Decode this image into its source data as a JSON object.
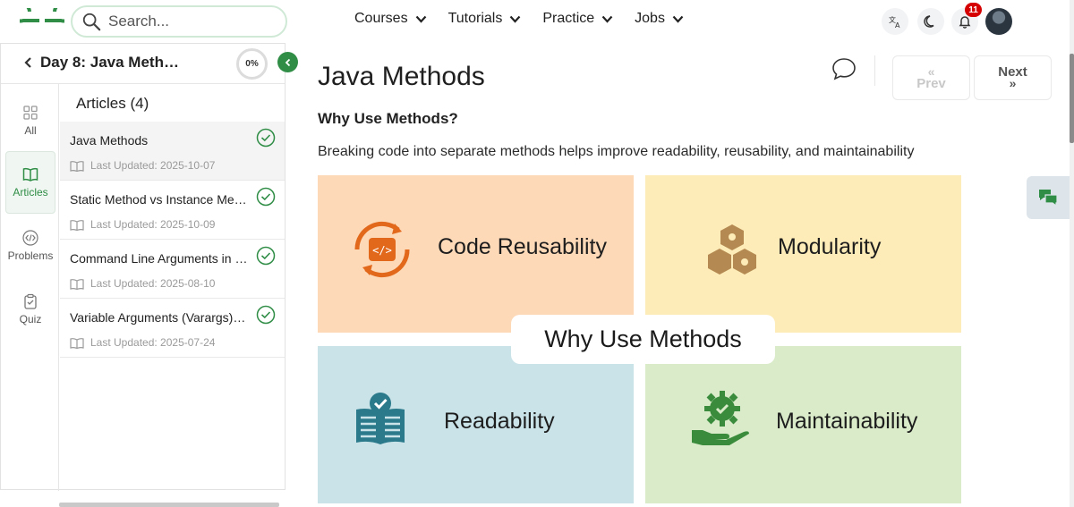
{
  "colors": {
    "brand": "#2f8d46",
    "badge": "#d50000"
  },
  "header": {
    "search_placeholder": "Search...",
    "nav": [
      {
        "label": "Courses"
      },
      {
        "label": "Tutorials"
      },
      {
        "label": "Practice"
      },
      {
        "label": "Jobs"
      }
    ],
    "notification_count": "11",
    "icons": [
      "translate-icon",
      "dark-mode-moon-icon",
      "bell-icon",
      "avatar"
    ]
  },
  "course": {
    "title": "Day 8: Java Meth…",
    "progress": "0%",
    "rail": [
      {
        "label": "All",
        "icon": "grid-icon"
      },
      {
        "label": "Articles",
        "icon": "book-icon",
        "active": true
      },
      {
        "label": "Problems",
        "icon": "code-icon"
      },
      {
        "label": "Quiz",
        "icon": "clipboard-check-icon"
      }
    ],
    "articles_heading": "Articles (4)",
    "articles": [
      {
        "title": "Java Methods",
        "updated": "Last Updated: 2025-10-07",
        "done": true
      },
      {
        "title": "Static Method vs Instance Met…",
        "updated": "Last Updated: 2025-10-09",
        "done": true
      },
      {
        "title": "Command Line Arguments in J…",
        "updated": "Last Updated: 2025-08-10",
        "done": true
      },
      {
        "title": "Variable Arguments (Varargs) i…",
        "updated": "Last Updated: 2025-07-24",
        "done": true
      }
    ]
  },
  "main": {
    "title": "Java Methods",
    "section_heading": "Why Use Methods?",
    "paragraph": "Breaking code into separate methods helps improve readability, reusability, and maintainability",
    "prev_label": "Prev",
    "next_label": "Next",
    "figure": {
      "center_label": "Why Use Methods",
      "quadrants": [
        {
          "label": "Code Reusability"
        },
        {
          "label": "Modularity"
        },
        {
          "label": "Readability"
        },
        {
          "label": "Maintainability"
        }
      ]
    }
  }
}
